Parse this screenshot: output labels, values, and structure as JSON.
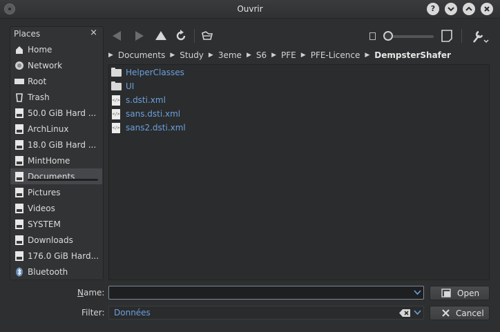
{
  "window": {
    "title": "Ouvrir"
  },
  "places": {
    "header": "Places",
    "items": [
      {
        "label": "Home",
        "icon": "home-icon"
      },
      {
        "label": "Network",
        "icon": "network-icon"
      },
      {
        "label": "Root",
        "icon": "root-icon"
      },
      {
        "label": "Trash",
        "icon": "trash-icon"
      },
      {
        "label": "50.0 GiB Hard ...",
        "icon": "hard-drive-icon"
      },
      {
        "label": "ArchLinux",
        "icon": "hard-drive-icon"
      },
      {
        "label": "18.0 GiB Hard ...",
        "icon": "hard-drive-icon"
      },
      {
        "label": "MintHome",
        "icon": "hard-drive-icon"
      },
      {
        "label": "Documents",
        "icon": "hard-drive-icon",
        "selected": true
      },
      {
        "label": "Pictures",
        "icon": "hard-drive-icon"
      },
      {
        "label": "Videos",
        "icon": "hard-drive-icon"
      },
      {
        "label": "SYSTEM",
        "icon": "hard-drive-icon"
      },
      {
        "label": "Downloads",
        "icon": "hard-drive-icon"
      },
      {
        "label": "176.0 GiB Hard...",
        "icon": "hard-drive-icon"
      },
      {
        "label": "Bluetooth",
        "icon": "bluetooth-icon"
      }
    ]
  },
  "breadcrumb": [
    "Documents",
    "Study",
    "3eme",
    "S6",
    "PFE",
    "PFE-Licence",
    "DempsterShafer"
  ],
  "files": [
    {
      "name": "HelperClasses",
      "type": "folder"
    },
    {
      "name": "UI",
      "type": "folder"
    },
    {
      "name": "s.dsti.xml",
      "type": "xml"
    },
    {
      "name": "sans.dsti.xml",
      "type": "xml"
    },
    {
      "name": "sans2.dsti.xml",
      "type": "xml"
    }
  ],
  "form": {
    "name_label_mnemonic": "N",
    "name_label_rest": "ame:",
    "name_value": "",
    "filter_label": "Filter:",
    "filter_value": "Données",
    "open_label": "Open",
    "cancel_label": "Cancel"
  },
  "colors": {
    "link": "#6aa0e0",
    "background": "#2e2f30"
  }
}
